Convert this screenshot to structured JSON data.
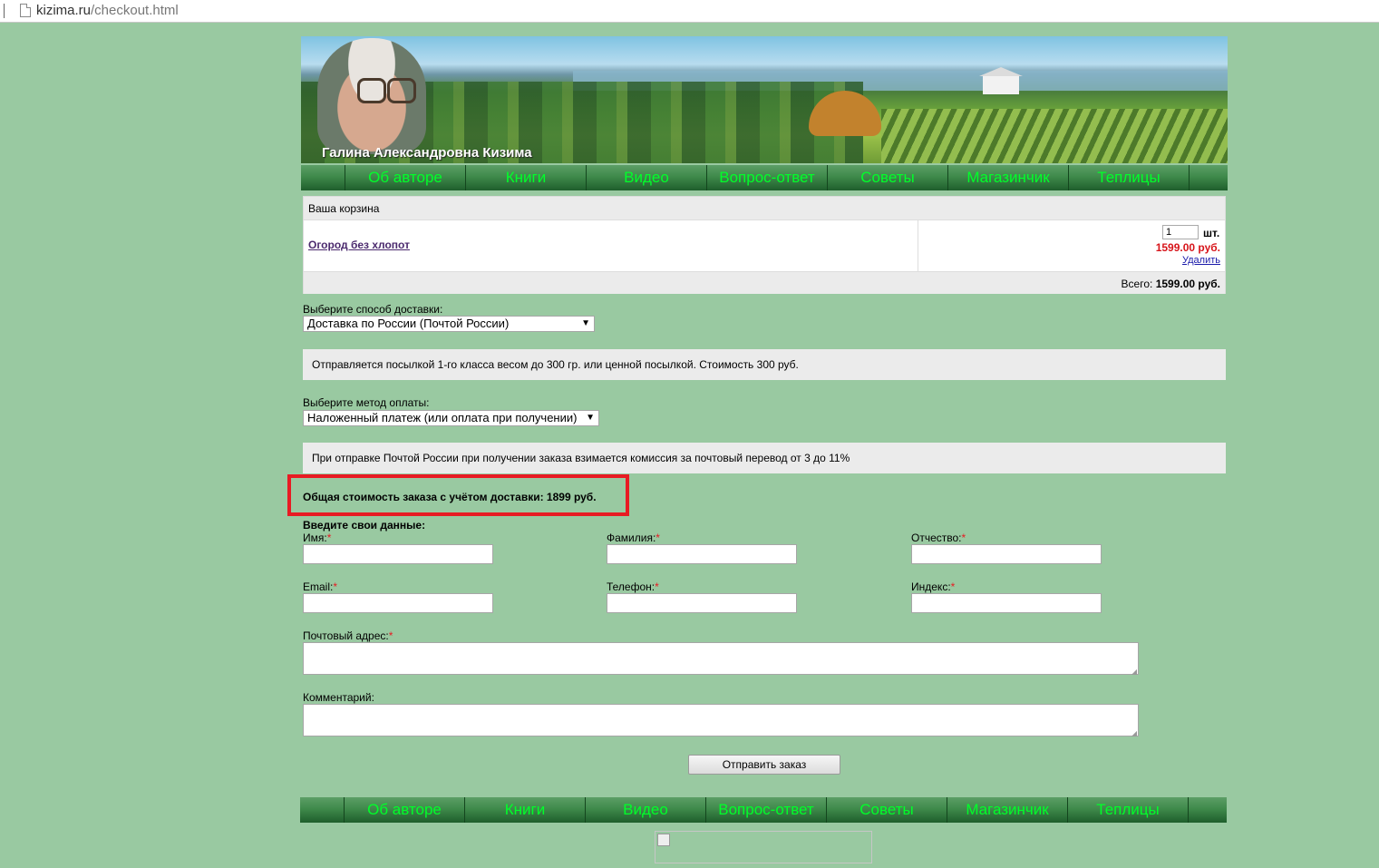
{
  "browser": {
    "domain": "kizima.ru",
    "path": "/checkout.html"
  },
  "header": {
    "author_name": "Галина Александровна Кизима"
  },
  "nav": {
    "items": [
      "Об авторе",
      "Книги",
      "Видео",
      "Вопрос-ответ",
      "Советы",
      "Магазинчик",
      "Теплицы"
    ]
  },
  "cart": {
    "title": "Ваша корзина",
    "item": {
      "name": "Огород без хлопот",
      "quantity": "1",
      "unit": "шт.",
      "price": "1599.00 руб.",
      "delete_label": "Удалить"
    },
    "total_label": "Всего:",
    "total_value": "1599.00 руб."
  },
  "delivery": {
    "label": "Выберите способ доставки:",
    "selected": "Доставка по России (Почтой России)",
    "info": "Отправляется посылкой 1-го класса весом до 300 гр. или ценной посылкой. Стоимость 300 руб."
  },
  "payment": {
    "label": "Выберите метод оплаты:",
    "selected": "Наложенный платеж (или оплата при получении)",
    "info": "При отправке Почтой России при получении заказа взимается комиссия за почтовый перевод от 3 до 11%"
  },
  "order_total": "Общая стоимость заказа с учётом доставки: 1899 руб.",
  "form": {
    "title": "Введите свои данные:",
    "first_name": "Имя:",
    "last_name": "Фамилия:",
    "patronymic": "Отчество:",
    "email": "Email:",
    "phone": "Телефон:",
    "postcode": "Индекс:",
    "address": "Почтовый адрес:",
    "comment": "Комментарий:",
    "required_mark": "*",
    "submit": "Отправить заказ"
  },
  "colors": {
    "page_bg": "#99c9a1",
    "nav_text": "#00ff2a",
    "price": "#d7141a",
    "highlight": "#e81b23"
  }
}
